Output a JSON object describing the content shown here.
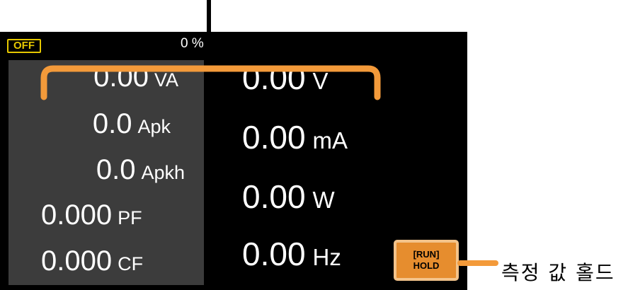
{
  "status": {
    "output_state": "OFF",
    "load_percent": "0 %"
  },
  "left_measurements": [
    {
      "value": "0.00",
      "unit": "VA"
    },
    {
      "value": "0.0",
      "unit": "Apk"
    },
    {
      "value": "0.0",
      "unit": "Apkh"
    },
    {
      "value": "0.000",
      "unit": "PF"
    },
    {
      "value": "0.000",
      "unit": "CF"
    }
  ],
  "right_measurements": [
    {
      "value": "0.00",
      "unit": "V"
    },
    {
      "value": "0.00",
      "unit": "mA"
    },
    {
      "value": "0.00",
      "unit": "W"
    },
    {
      "value": "0.00",
      "unit": "Hz"
    }
  ],
  "hold_button": {
    "line1": "[RUN]",
    "line2": "HOLD"
  },
  "annotation": {
    "hold_caption": "측정 값 홀드"
  },
  "colors": {
    "off_badge": "#e6c800",
    "hold_button": "#e68d2e",
    "callout": "#f39a3a",
    "left_panel": "#3c3c3c"
  }
}
